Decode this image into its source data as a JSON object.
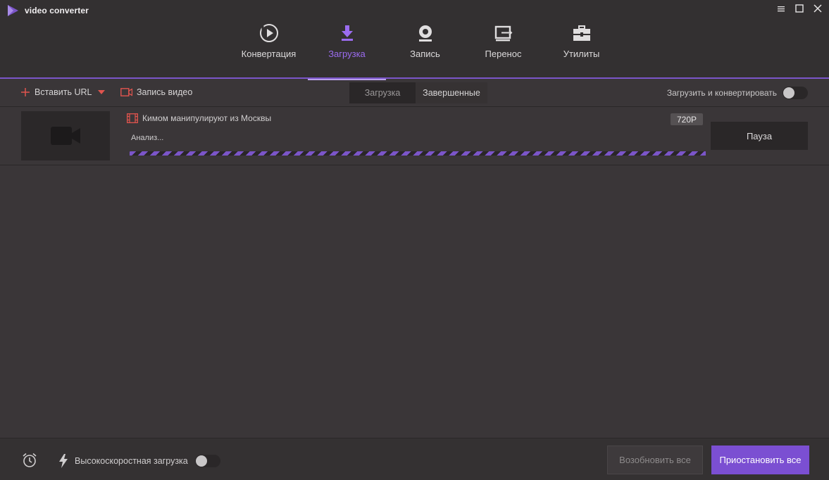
{
  "app": {
    "title": "video converter",
    "accent_color": "#7b55c9",
    "window_controls": [
      "minimize-icon",
      "maximize-icon",
      "close-icon"
    ]
  },
  "nav": {
    "items": [
      {
        "label": "Конвертация",
        "icon": "convert-play-icon",
        "active": false
      },
      {
        "label": "Загрузка",
        "icon": "download-arrow-icon",
        "active": true
      },
      {
        "label": "Запись",
        "icon": "record-webcam-icon",
        "active": false
      },
      {
        "label": "Перенос",
        "icon": "transfer-device-icon",
        "active": false
      },
      {
        "label": "Утилиты",
        "icon": "toolbox-icon",
        "active": false
      }
    ]
  },
  "toolbar": {
    "paste_url_label": "Вставить URL",
    "record_video_label": "Запись видео",
    "tabs": [
      {
        "label": "Загрузка",
        "active": true
      },
      {
        "label": "Завершенные",
        "active": false
      }
    ],
    "download_convert_label": "Загрузить и конвертировать",
    "download_convert_enabled": false
  },
  "downloads": [
    {
      "title": " Кимом  манипулируют из Москвы",
      "resolution": "720P",
      "status": "Анализ...",
      "action_label": "Пауза"
    }
  ],
  "footer": {
    "high_speed_label": "Высокоскоростная загрузка",
    "high_speed_enabled": false,
    "resume_all_label": "Возобновить все",
    "pause_all_label": "Приостановить все"
  }
}
